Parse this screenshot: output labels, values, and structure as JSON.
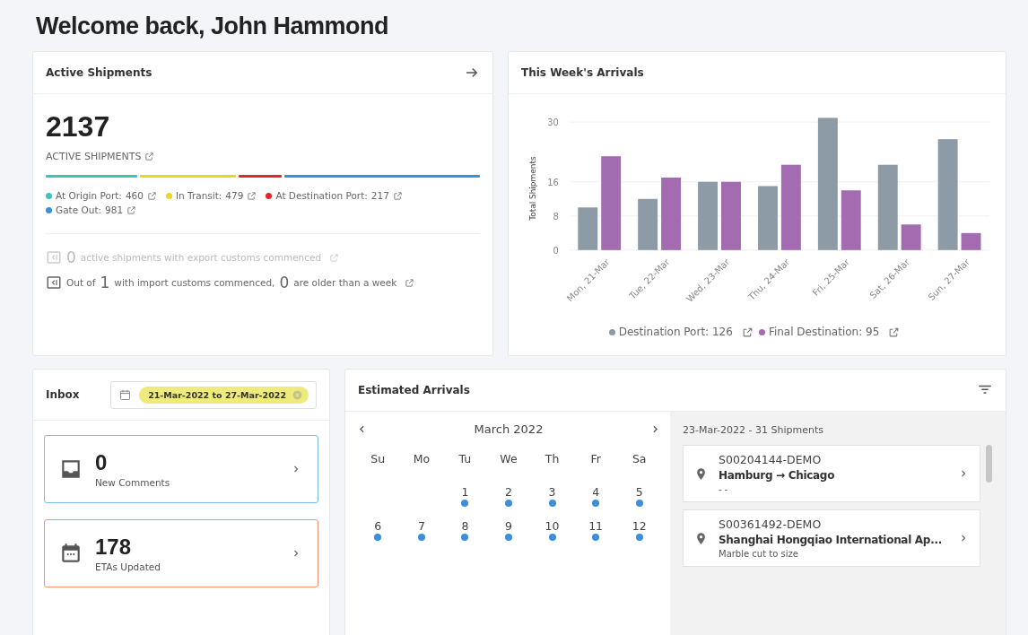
{
  "page_title": "Welcome back, John Hammond",
  "active_shipments": {
    "title": "Active Shipments",
    "total": "2137",
    "total_label": "ACTIVE SHIPMENTS",
    "statuses": [
      {
        "label": "At Origin Port:",
        "count": "460",
        "color": "#3cc4bc"
      },
      {
        "label": "In Transit:",
        "count": "479",
        "color": "#e8d72a"
      },
      {
        "label": "At Destination Port:",
        "count": "217",
        "color": "#e3262d"
      },
      {
        "label": "Gate Out:",
        "count": "981",
        "color": "#3a8ee0"
      }
    ],
    "customs": [
      {
        "disabled": true,
        "parts": [
          {
            "kind": "number",
            "text": "0"
          },
          {
            "kind": "text",
            "text": "active shipments with export customs commenced"
          }
        ]
      },
      {
        "disabled": false,
        "parts": [
          {
            "kind": "text",
            "text": "Out of"
          },
          {
            "kind": "number",
            "text": "1"
          },
          {
            "kind": "text",
            "text": "with import customs commenced,"
          },
          {
            "kind": "number",
            "text": "0"
          },
          {
            "kind": "text",
            "text": "are older than a week"
          }
        ]
      }
    ]
  },
  "arrivals_chart": {
    "title": "This Week's Arrivals",
    "chart_data": {
      "type": "bar",
      "ylabel": "Total Shipments",
      "categories": [
        "Mon, 21-Mar",
        "Tue, 22-Mar",
        "Wed, 23-Mar",
        "Thu, 24-Mar",
        "Fri, 25-Mar",
        "Sat, 26-Mar",
        "Sun, 27-Mar"
      ],
      "series": [
        {
          "name": "Destination Port",
          "color": "#8c9ba6",
          "values": [
            10,
            12,
            16,
            15,
            31,
            20,
            26
          ]
        },
        {
          "name": "Final Destination",
          "color": "#a36bb0",
          "values": [
            22,
            17,
            16,
            20,
            14,
            6,
            4
          ]
        }
      ],
      "ylim": [
        0,
        31
      ],
      "yticks": [
        0,
        8,
        16,
        30
      ],
      "grid": true
    },
    "legend_totals": [
      ": 126",
      ": 95"
    ]
  },
  "inbox": {
    "title": "Inbox",
    "date_range": "21-Mar-2022 to 27-Mar-2022",
    "tiles": [
      {
        "kind": "inbox",
        "count": "0",
        "label": "New Comments",
        "color": "#7bbde9"
      },
      {
        "kind": "calendar",
        "count": "178",
        "label": "ETAs Updated",
        "color": "#f39373"
      }
    ]
  },
  "estimated_arrivals": {
    "title": "Estimated Arrivals",
    "month": "March 2022",
    "weekdays": [
      "Su",
      "Mo",
      "Tu",
      "We",
      "Th",
      "Fr",
      "Sa"
    ],
    "weeks": [
      {
        "right_aligned": true,
        "days": [
          {
            "day": "1",
            "has_arrivals": true
          },
          {
            "day": "2",
            "has_arrivals": true
          },
          {
            "day": "3",
            "has_arrivals": true
          },
          {
            "day": "4",
            "has_arrivals": true
          },
          {
            "day": "5",
            "has_arrivals": true
          }
        ]
      },
      {
        "right_aligned": false,
        "days": [
          {
            "day": "6",
            "has_arrivals": true
          },
          {
            "day": "7",
            "has_arrivals": true
          },
          {
            "day": "8",
            "has_arrivals": true
          },
          {
            "day": "9",
            "has_arrivals": true
          },
          {
            "day": "10",
            "has_arrivals": true
          },
          {
            "day": "11",
            "has_arrivals": true
          },
          {
            "day": "12",
            "has_arrivals": true
          }
        ]
      }
    ],
    "list_heading": "23-Mar-2022 - 31 Shipments",
    "shipments": [
      {
        "id": "S00204144-DEMO",
        "route": "Hamburg → Chicago",
        "note": "- -"
      },
      {
        "id": "S00361492-DEMO",
        "route": "Shanghai Hongqiao International Ap...",
        "note": "Marble cut to size"
      }
    ]
  }
}
